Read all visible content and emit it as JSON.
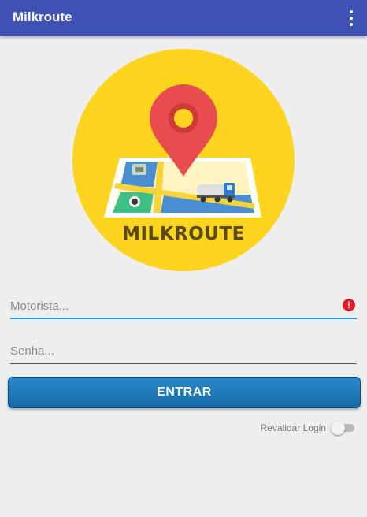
{
  "appbar": {
    "title": "Milkroute",
    "menu_icon": "more-vert-icon",
    "color": "#3f51b5"
  },
  "logo": {
    "text": "MILKROUTE",
    "icon": "map-pin-icon",
    "circle_color": "#fdd41e"
  },
  "form": {
    "driver_placeholder": "Motorista...",
    "driver_value": "",
    "driver_error_icon": "error-icon",
    "password_placeholder": "Senha...",
    "password_value": "",
    "enter_label": "ENTRAR",
    "revalidate_label": "Revalidar Login",
    "revalidate_on": false
  }
}
